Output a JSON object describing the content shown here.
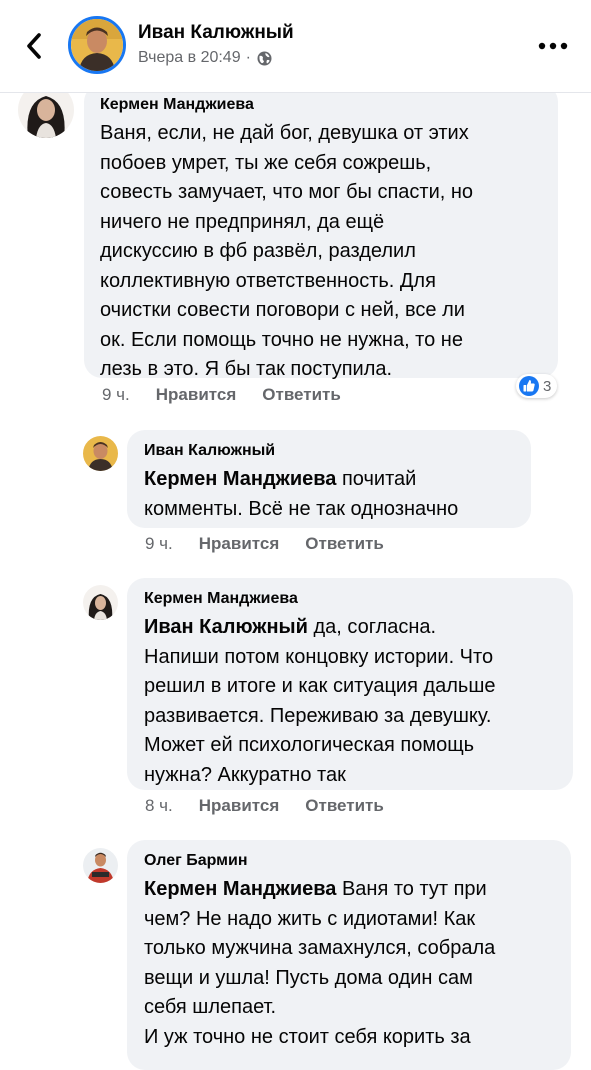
{
  "header": {
    "name": "Иван Калюжный",
    "time": "Вчера в 20:49",
    "separator": "·"
  },
  "comments": [
    {
      "author": "Кермен Манджиева",
      "lines": [
        "Ваня, если, не дай бог, девушка от этих",
        "побоев умрет, ты же себя сожрешь,",
        "совесть замучает, что мог бы спасти, но",
        "ничего не предпринял, да ещё",
        "дискуссию в фб развёл, разделил",
        "коллективную ответственность. Для",
        "очистки совести поговори с ней, все ли",
        "ок. Если помощь точно не нужна, то не",
        "лезь в это. Я бы так поступила."
      ],
      "time": "9 ч.",
      "like": "Нравится",
      "reply": "Ответить",
      "reaction_count": "3"
    },
    {
      "author": "Иван Калюжный",
      "mention": "Кермен Манджиева",
      "line1_rest": " почитай",
      "lines": [
        "комменты. Всё не так однозначно"
      ],
      "time": "9 ч.",
      "like": "Нравится",
      "reply": "Ответить"
    },
    {
      "author": "Кермен Манджиева",
      "mention": "Иван Калюжный",
      "line1_rest": "  да, согласна.",
      "lines": [
        "Напиши потом концовку истории. Что",
        "решил в итоге и как ситуация дальше",
        "развивается. Переживаю за девушку.",
        "Может ей психологическая помощь",
        "нужна? Аккуратно так"
      ],
      "time": "8 ч.",
      "like": "Нравится",
      "reply": "Ответить"
    },
    {
      "author": "Олег Бармин",
      "mention": "Кермен Манджиева",
      "line1_rest": " Ваня то тут при",
      "lines": [
        "чем? Не надо жить с идиотами! Как",
        "только мужчина замахнулся, собрала",
        "вещи и ушла! Пусть дома один сам",
        "себя шлепает.",
        "И уж точно не стоит себя корить за"
      ]
    }
  ],
  "colors": {
    "accent": "#1877f2",
    "bubble": "#f0f2f5",
    "meta": "#65676b",
    "text": "#050505"
  },
  "icons": {
    "back": "chevron-left-icon",
    "globe": "globe-icon",
    "more": "more-dots-icon",
    "like_reaction": "thumbs-up-icon"
  }
}
